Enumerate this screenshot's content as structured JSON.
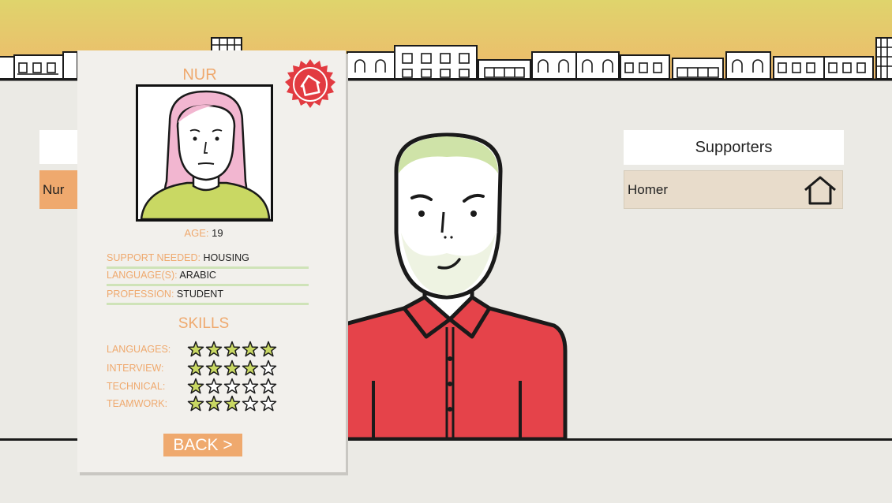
{
  "left_panel": {
    "selected_item": "Nur"
  },
  "supporters_panel": {
    "title": "Supporters",
    "items": [
      {
        "name": "Homer",
        "icon": "house-icon"
      }
    ]
  },
  "profile_card": {
    "name": "NUR",
    "badge_icon": "house-badge-icon",
    "age_label": "AGE:",
    "age": "19",
    "rows": [
      {
        "label": "SUPPORT NEEDED:",
        "value": "HOUSING"
      },
      {
        "label": "LANGUAGE(S):",
        "value": "ARABIC"
      },
      {
        "label": "PROFESSION:",
        "value": "STUDENT"
      }
    ],
    "skills_title": "SKILLS",
    "skills": [
      {
        "label": "LANGUAGES:",
        "rating": 5
      },
      {
        "label": "INTERVIEW:",
        "rating": 4
      },
      {
        "label": "TECHNICAL:",
        "rating": 1
      },
      {
        "label": "TEAMWORK:",
        "rating": 3
      }
    ],
    "skills_max": 5,
    "back_label": "BACK >"
  },
  "colors": {
    "accent_orange": "#efa96e",
    "shirt_red": "#e5434a",
    "badge_red": "#e23b41",
    "hair_green": "#cfe3a8",
    "hair_pink": "#f2b6d0",
    "star_fill": "#c9d863",
    "divider_green": "#cfe3b8"
  }
}
